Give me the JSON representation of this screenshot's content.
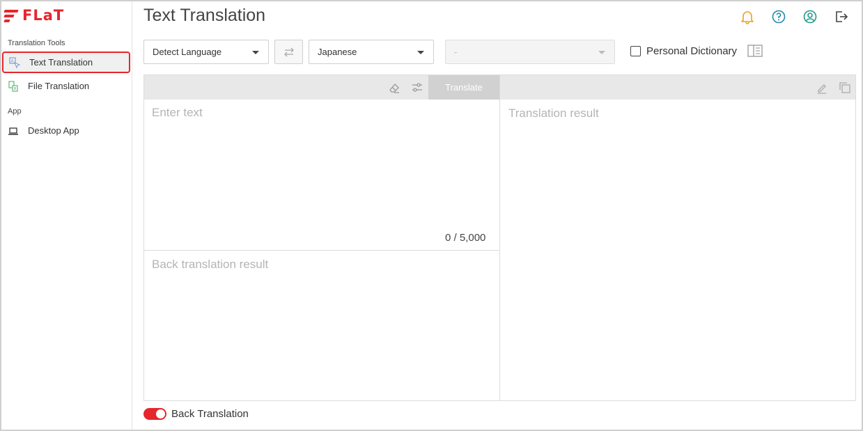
{
  "brand": {
    "logo_text": "FLaT",
    "accent": "#e5262d"
  },
  "sidebar": {
    "sections": [
      {
        "label": "Translation Tools"
      },
      {
        "label": "App"
      }
    ],
    "items": [
      {
        "label": "Text Translation",
        "icon": "text-translate-icon",
        "active": true
      },
      {
        "label": "File Translation",
        "icon": "file-translate-icon",
        "active": false
      },
      {
        "label": "Desktop App",
        "icon": "laptop-icon",
        "active": false
      }
    ]
  },
  "header": {
    "title": "Text Translation",
    "icons": [
      "bell-icon",
      "help-icon",
      "account-icon",
      "logout-icon"
    ],
    "bell_color": "#f0a020",
    "icon_color": "#1f8aa8"
  },
  "controls": {
    "source_language": "Detect Language",
    "target_language": "Japanese",
    "third_select": "-",
    "personal_dictionary_label": "Personal Dictionary",
    "personal_dictionary_checked": false
  },
  "editor": {
    "translate_button": "Translate",
    "input_placeholder": "Enter text",
    "char_count": "0 / 5,000",
    "result_placeholder": "Translation result",
    "back_translation_placeholder": "Back translation result"
  },
  "footer": {
    "back_translation_label": "Back Translation",
    "back_translation_on": true
  }
}
